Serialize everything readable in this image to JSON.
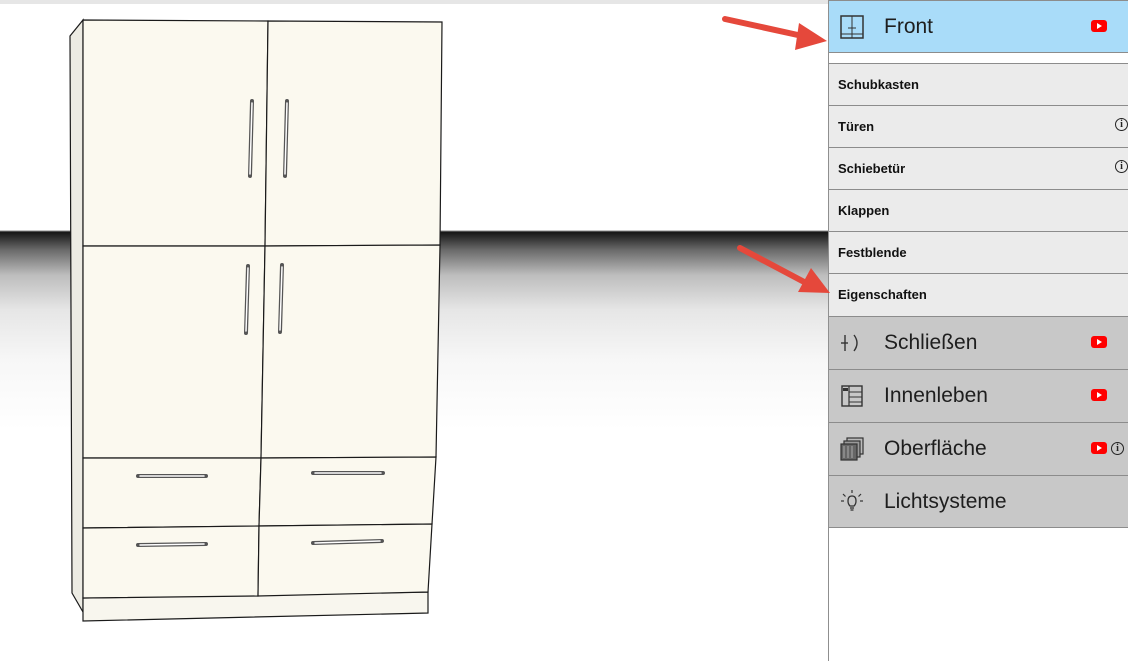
{
  "panel": {
    "front": {
      "label": "Front",
      "icon": "front-panel-icon",
      "video": "youtube-icon"
    },
    "front_items": [
      {
        "label": "Schubkasten",
        "info": false
      },
      {
        "label": "Türen",
        "info": true
      },
      {
        "label": "Schiebetür",
        "info": true
      },
      {
        "label": "Klappen",
        "info": false
      },
      {
        "label": "Festblende",
        "info": false
      },
      {
        "label": "Eigenschaften",
        "info": false
      }
    ],
    "sections": [
      {
        "label": "Schließen",
        "icon": "lock-icon",
        "video": true,
        "info": false
      },
      {
        "label": "Innenleben",
        "icon": "interior-icon",
        "video": true,
        "info": false
      },
      {
        "label": "Oberfläche",
        "icon": "surface-icon",
        "video": true,
        "info": true
      },
      {
        "label": "Lichtsysteme",
        "icon": "lightbulb-icon",
        "video": false,
        "info": false
      }
    ]
  },
  "colors": {
    "active": "#a9dcf9",
    "section": "#c8c8c8",
    "subitem": "#ebebeb",
    "arrow": "#e5483b",
    "youtube": "#ff0000"
  }
}
